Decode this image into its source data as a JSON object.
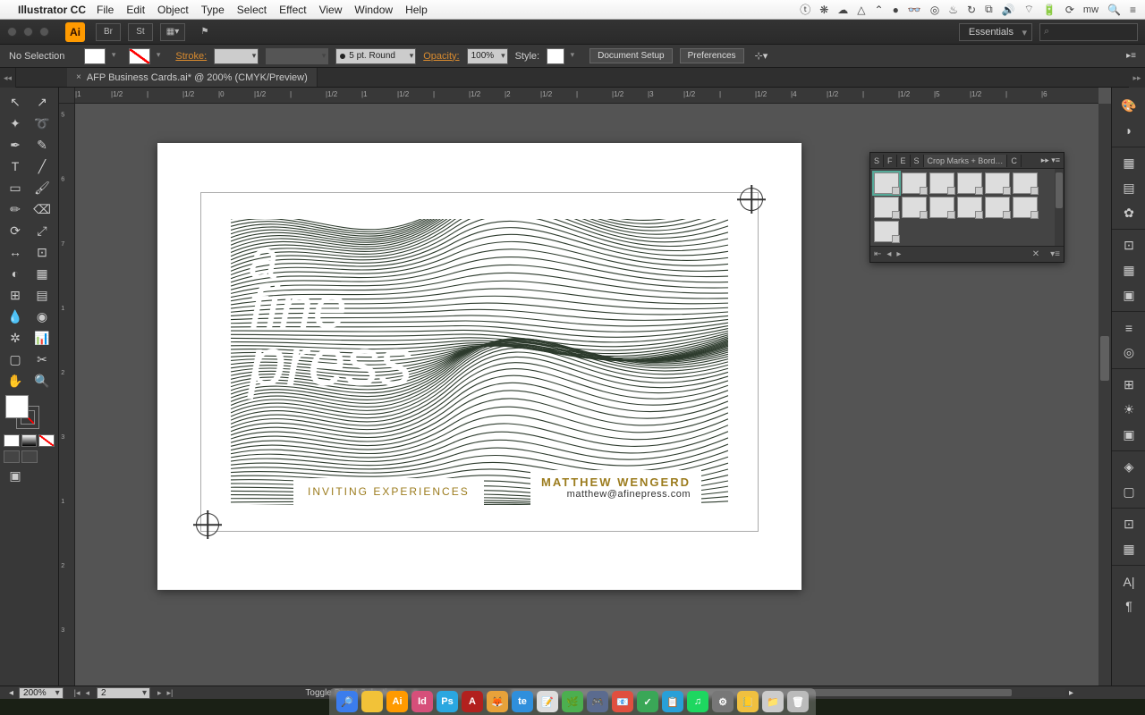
{
  "mac_menu": {
    "app": "Illustrator CC",
    "items": [
      "File",
      "Edit",
      "Object",
      "Type",
      "Select",
      "Effect",
      "View",
      "Window",
      "Help"
    ],
    "user": "mw"
  },
  "titlebar": {
    "workspace": "Essentials",
    "search_placeholder": "⌕"
  },
  "controlbar": {
    "selection": "No Selection",
    "stroke_label": "Stroke:",
    "stroke_weight": "",
    "profile": "5 pt. Round",
    "opacity_label": "Opacity:",
    "opacity": "100%",
    "style_label": "Style:",
    "doc_setup": "Document Setup",
    "prefs": "Preferences"
  },
  "document": {
    "tab": "AFP Business Cards.ai* @ 200% (CMYK/Preview)"
  },
  "ruler_h": [
    "|1",
    "|1/2",
    "|",
    "|1/2",
    "|0",
    "|1/2",
    "|",
    "|1/2",
    "|1",
    "|1/2",
    "|",
    "|1/2",
    "|2",
    "|1/2",
    "|",
    "|1/2",
    "|3",
    "|1/2",
    "|",
    "|1/2",
    "|4",
    "|1/2",
    "|",
    "|1/2",
    "|5",
    "|1/2",
    "|",
    "|6"
  ],
  "ruler_v": [
    "5",
    "6",
    "7",
    "1",
    "2",
    "3",
    "1",
    "2",
    "3"
  ],
  "card": {
    "script1": "a",
    "script2": "fine",
    "script3": "press",
    "tagline": "INVITING EXPERIENCES",
    "name": "MATTHEW WENGERD",
    "email": "matthew@afinepress.com"
  },
  "artboards_panel": {
    "tabs": [
      "S",
      "F",
      "E",
      "S",
      "Crop Marks + Bord…",
      "C"
    ],
    "count": 13
  },
  "statusbar": {
    "zoom": "200%",
    "artboard_num": "2",
    "hint": "Toggle Direct Selection"
  },
  "dock_apps": [
    {
      "bg": "#3b7ded",
      "t": "🔎"
    },
    {
      "bg": "#f2c238",
      "t": ""
    },
    {
      "bg": "#ff9a00",
      "t": "Ai"
    },
    {
      "bg": "#d64f7a",
      "t": "Id"
    },
    {
      "bg": "#2aa7e0",
      "t": "Ps"
    },
    {
      "bg": "#b2211e",
      "t": "A"
    },
    {
      "bg": "#e8a23a",
      "t": "🦊"
    },
    {
      "bg": "#2f8fdc",
      "t": "te"
    },
    {
      "bg": "#ddd",
      "t": "📝"
    },
    {
      "bg": "#4caf50",
      "t": "🌿"
    },
    {
      "bg": "#5b6b8f",
      "t": "🎮"
    },
    {
      "bg": "#e04f3f",
      "t": "📧"
    },
    {
      "bg": "#3aa757",
      "t": "✓"
    },
    {
      "bg": "#28a0d8",
      "t": "📋"
    },
    {
      "bg": "#1ed760",
      "t": "♫"
    },
    {
      "bg": "#777",
      "t": "⚙"
    },
    {
      "bg": "#f0c040",
      "t": "📒"
    },
    {
      "bg": "#ccc",
      "t": "📁"
    },
    {
      "bg": "#bbb",
      "t": "🗑"
    }
  ]
}
